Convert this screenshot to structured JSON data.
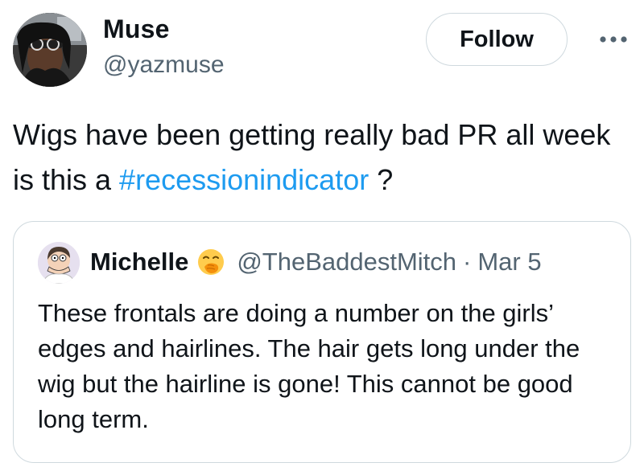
{
  "author": {
    "display_name": "Muse",
    "handle": "@yazmuse",
    "avatar_icon": "profile-photo"
  },
  "actions": {
    "follow_label": "Follow",
    "more_icon": "ellipsis-icon"
  },
  "tweet": {
    "text_before": "Wigs have been getting really bad PR all week is this a ",
    "hashtag": "#recessionindicator",
    "text_after": " ?",
    "hashtag_color": "#1d9bf0"
  },
  "quoted_tweet": {
    "display_name": "Michelle",
    "emoji_icon": "hand-over-mouth-emoji",
    "handle": "@TheBaddestMitch",
    "separator": "·",
    "date": "Mar 5",
    "text": "These frontals are doing a number on the girls’ edges and hairlines. The hair gets long under the wig but the hairline is gone! This cannot be good long term."
  },
  "colors": {
    "primary_text": "#0f1419",
    "secondary_text": "#536471",
    "border": "#cfd9de",
    "link": "#1d9bf0"
  }
}
